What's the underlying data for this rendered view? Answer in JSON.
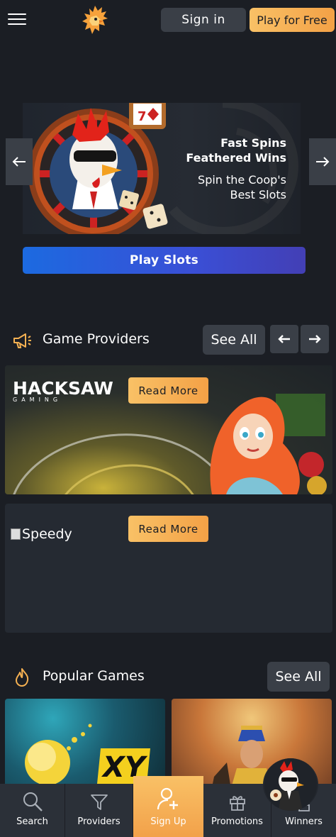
{
  "header": {
    "menu_icon": "hamburger-icon",
    "logo_icon": "rooster-logo-icon",
    "signin_label": "Sign in",
    "play_free_label": "Play for Free"
  },
  "hero": {
    "title_line1": "Fast Spins",
    "title_line2": "Feathered Wins",
    "subtitle_line1": "Spin the Coop's",
    "subtitle_line2": "Best Slots",
    "cta_label": "Play Slots",
    "prev_icon": "arrow-left-icon",
    "next_icon": "arrow-right-icon"
  },
  "providers": {
    "title": "Game Providers",
    "see_all": "See All",
    "icon": "megaphone-icon",
    "items": [
      {
        "logo_text": "HACKSAW",
        "logo_sub": "GAMING",
        "cta": "Read More"
      },
      {
        "alt_text": "Speedy",
        "cta": "Read More"
      }
    ]
  },
  "popular": {
    "title": "Popular Games",
    "see_all": "See All",
    "icon": "flame-icon",
    "tile1_text": "XY"
  },
  "bottom_nav": {
    "items": [
      {
        "label": "Search",
        "icon": "search-icon"
      },
      {
        "label": "Providers",
        "icon": "filter-icon"
      },
      {
        "label": "Sign Up",
        "icon": "add-user-icon"
      },
      {
        "label": "Promotions",
        "icon": "gift-icon"
      },
      {
        "label": "Winners",
        "icon": "trophy-icon"
      }
    ]
  },
  "colors": {
    "background": "#1b1e24",
    "accent": "#f6b152",
    "button_dark": "#3a3f47",
    "cta_blue": "#2a5ee0"
  }
}
